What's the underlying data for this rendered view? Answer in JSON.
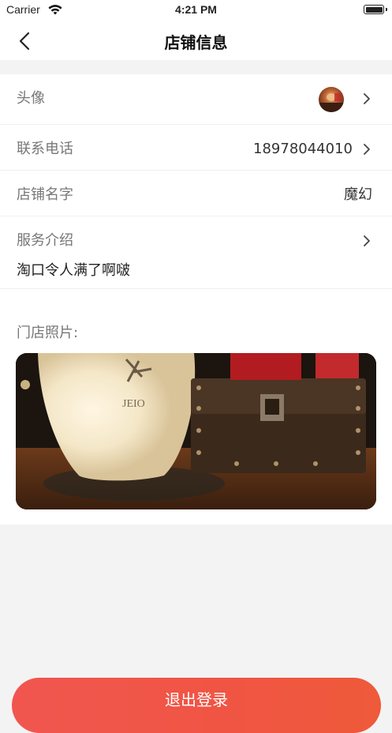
{
  "status_bar": {
    "carrier": "Carrier",
    "time": "4:21 PM"
  },
  "nav": {
    "title": "店铺信息",
    "back_icon": "chevron-left-icon"
  },
  "rows": {
    "avatar": {
      "label": "头像"
    },
    "phone": {
      "label": "联系电话",
      "value": "18978044010"
    },
    "shop_name": {
      "label": "店铺名字",
      "value": "魔幻"
    },
    "service": {
      "label": "服务介绍",
      "description": "淘口令人满了啊啵"
    }
  },
  "photos": {
    "label": "门店照片:"
  },
  "logout": {
    "label": "退出登录"
  },
  "colors": {
    "accent": "#f0564f",
    "background": "#f3f3f3"
  }
}
